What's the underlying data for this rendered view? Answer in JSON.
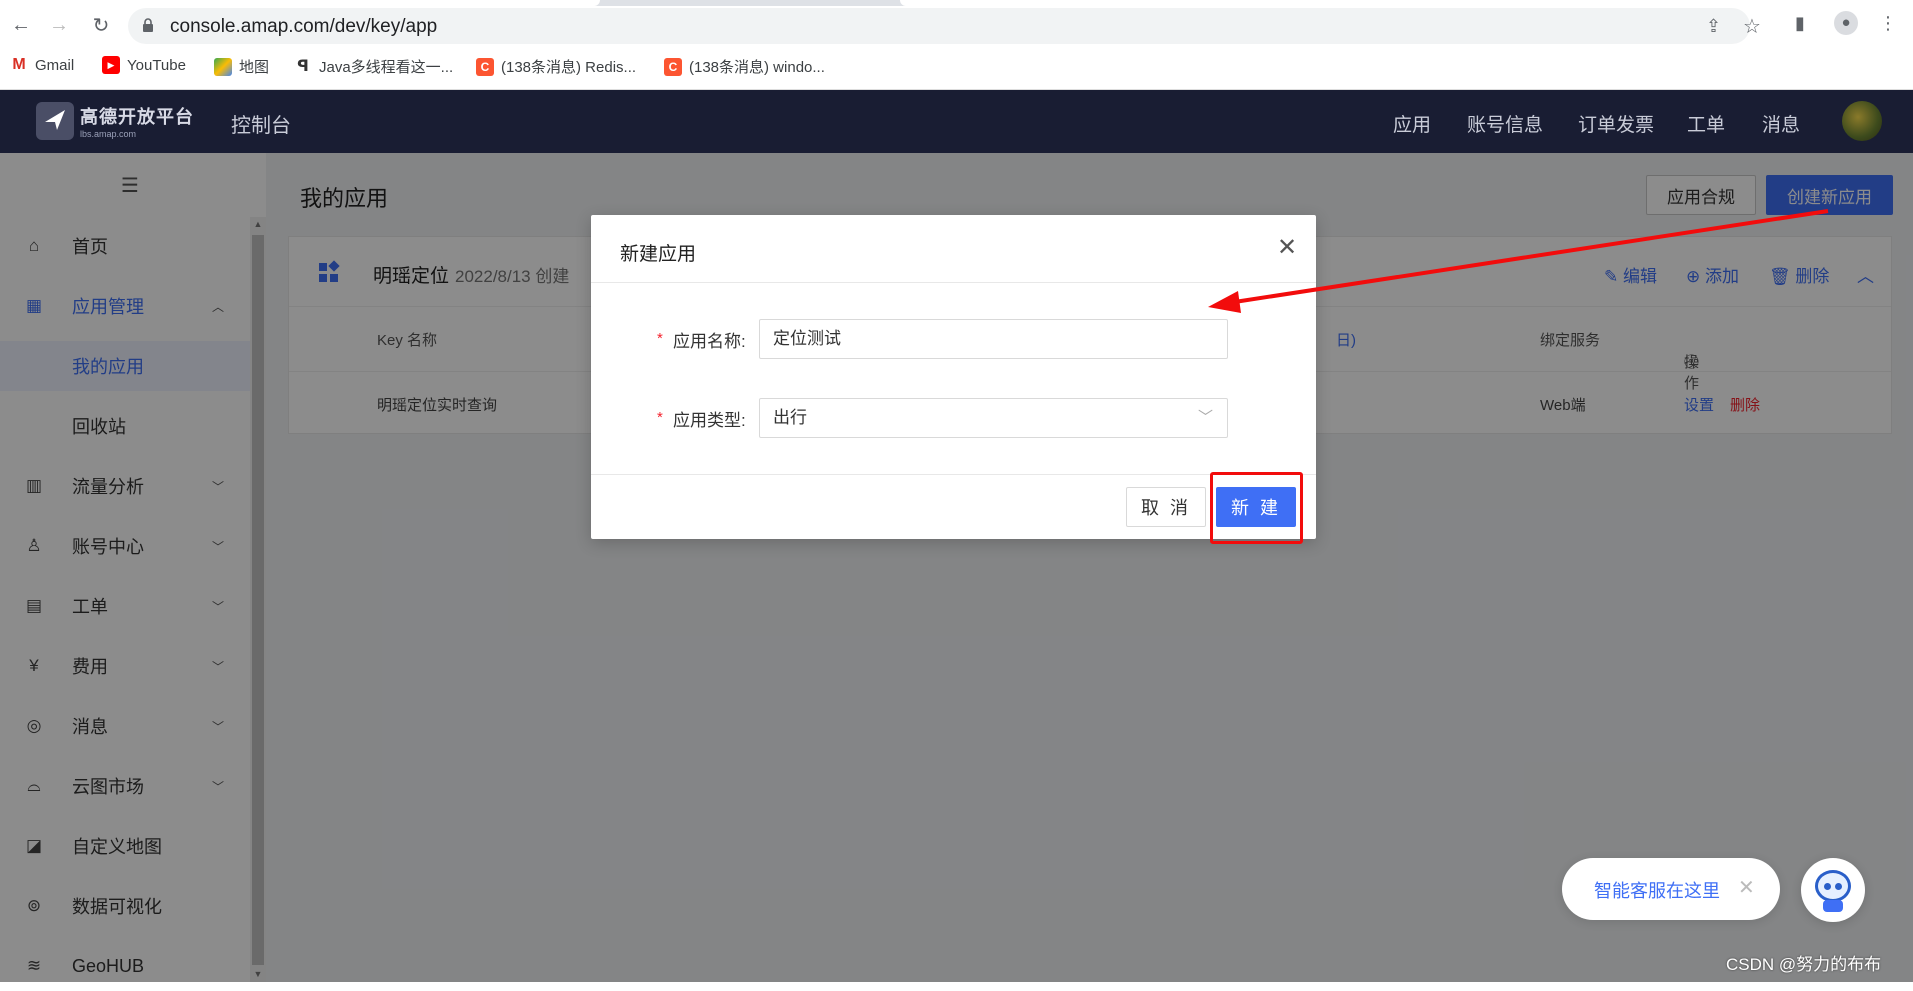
{
  "browser": {
    "url": "console.amap.com/dev/key/app",
    "bookmarks": [
      {
        "label": "Gmail",
        "icon": "gmail-icon"
      },
      {
        "label": "YouTube",
        "icon": "youtube-icon"
      },
      {
        "label": "地图",
        "icon": "maps-icon"
      },
      {
        "label": "Java多线程看这一...",
        "icon": "bookmark-site-icon"
      },
      {
        "label": "(138条消息) Redis...",
        "icon": "csdn-icon"
      },
      {
        "label": "(138条消息) windo...",
        "icon": "csdn-icon"
      }
    ]
  },
  "header": {
    "logo_text": "高德开放平台",
    "logo_sub": "lbs.amap.com",
    "console": "控制台",
    "nav": [
      "应用",
      "账号信息",
      "订单发票",
      "工单",
      "消息"
    ]
  },
  "sidebar": {
    "items": [
      {
        "label": "首页",
        "icon": "home-icon"
      },
      {
        "label": "应用管理",
        "icon": "apps-grid-icon"
      },
      {
        "label": "我的应用"
      },
      {
        "label": "回收站"
      },
      {
        "label": "流量分析",
        "icon": "chart-icon"
      },
      {
        "label": "账号中心",
        "icon": "user-icon"
      },
      {
        "label": "工单",
        "icon": "ticket-icon"
      },
      {
        "label": "费用",
        "icon": "money-icon"
      },
      {
        "label": "消息",
        "icon": "message-icon"
      },
      {
        "label": "云图市场",
        "icon": "store-icon"
      },
      {
        "label": "自定义地图",
        "icon": "custom-map-icon"
      },
      {
        "label": "数据可视化",
        "icon": "visualization-icon"
      },
      {
        "label": "GeoHUB",
        "icon": "layers-icon"
      }
    ]
  },
  "main": {
    "title": "我的应用",
    "compliance_button": "应用合规",
    "create_button": "创建新应用",
    "card": {
      "app_name": "明瑶定位",
      "created": "2022/8/13 创建",
      "edit": "编辑",
      "add": "添加",
      "delete": "删除",
      "columns": [
        "Key 名称",
        "绑定服务",
        "操作"
      ],
      "partial_col": "日)",
      "row": {
        "key_name": "明瑶定位实时查询",
        "service": "Web端",
        "settings": "设置",
        "delete": "删除"
      }
    }
  },
  "modal": {
    "title": "新建应用",
    "name_label": "应用名称:",
    "name_value": "定位测试",
    "type_label": "应用类型:",
    "type_value": "出行",
    "cancel": "取 消",
    "ok": "新 建"
  },
  "chat": {
    "text": "智能客服在这里"
  },
  "watermark": "CSDN @努力的布布",
  "colors": {
    "primary": "#3f6ff5",
    "header_bg": "#191d33",
    "annotation_red": "#f20c0c"
  }
}
